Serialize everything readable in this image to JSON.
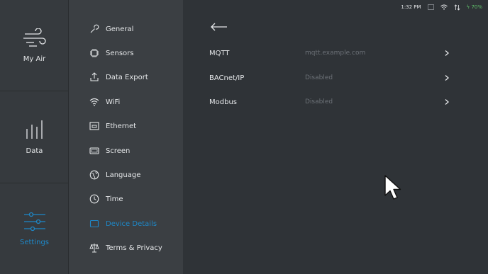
{
  "rail": {
    "items": [
      {
        "label": "My Air"
      },
      {
        "label": "Data"
      },
      {
        "label": "Settings"
      }
    ]
  },
  "menu": {
    "items": [
      {
        "label": "General",
        "icon": "wrench-icon"
      },
      {
        "label": "Sensors",
        "icon": "sensor-chip-icon"
      },
      {
        "label": "Data Export",
        "icon": "export-icon"
      },
      {
        "label": "WiFi",
        "icon": "wifi-icon"
      },
      {
        "label": "Ethernet",
        "icon": "ethernet-port-icon"
      },
      {
        "label": "Screen",
        "icon": "screen-icon"
      },
      {
        "label": "Language",
        "icon": "globe-icon"
      },
      {
        "label": "Time",
        "icon": "clock-icon"
      },
      {
        "label": "Device Details",
        "icon": "tablet-icon"
      },
      {
        "label": "Terms & Privacy",
        "icon": "scales-icon"
      }
    ],
    "active": "Device Details"
  },
  "status": {
    "time": "1:32 PM",
    "battery": "70%"
  },
  "main": {
    "rows": [
      {
        "label": "MQTT",
        "value": "mqtt.example.com"
      },
      {
        "label": "BACnet/IP",
        "value": "Disabled"
      },
      {
        "label": "Modbus",
        "value": "Disabled"
      }
    ]
  },
  "colors": {
    "accent": "#1e88c8",
    "battery": "#5fbf6a",
    "background": "#2f3337"
  }
}
